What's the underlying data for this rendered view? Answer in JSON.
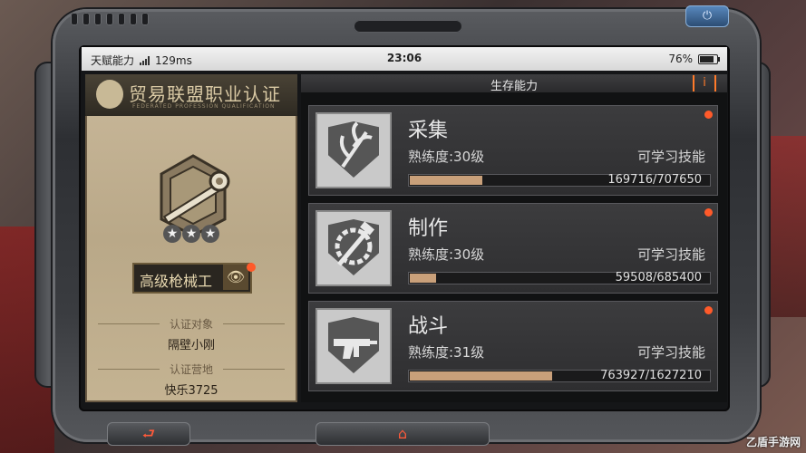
{
  "status_bar": {
    "carrier": "天赋能力",
    "ping": "129ms",
    "time": "23:06",
    "battery": "76%"
  },
  "left_panel": {
    "title": "贸易联盟职业认证",
    "subtitle": "FEDERATED PROFESSION QUALIFICATION",
    "rank": "高级枪械工",
    "stars": 3,
    "cert_target_label": "认证对象",
    "cert_target_value": "隔壁小刚",
    "cert_camp_label": "认证营地",
    "cert_camp_value": "快乐3725"
  },
  "right_panel": {
    "title": "生存能力",
    "info_icon": "i"
  },
  "skills": [
    {
      "name": "采集",
      "level": "熟练度:30级",
      "learn": "可学习技能",
      "progress": "169716/707650",
      "progress_fraction": 0.24
    },
    {
      "name": "制作",
      "level": "熟练度:30级",
      "learn": "可学习技能",
      "progress": "59508/685400",
      "progress_fraction": 0.087
    },
    {
      "name": "战斗",
      "level": "熟练度:31级",
      "learn": "可学习技能",
      "progress": "763927/1627210",
      "progress_fraction": 0.469
    }
  ],
  "watermark": "乙盾手游网",
  "colors": {
    "accent": "#ff5a2a",
    "progress": "#c9a07a"
  }
}
